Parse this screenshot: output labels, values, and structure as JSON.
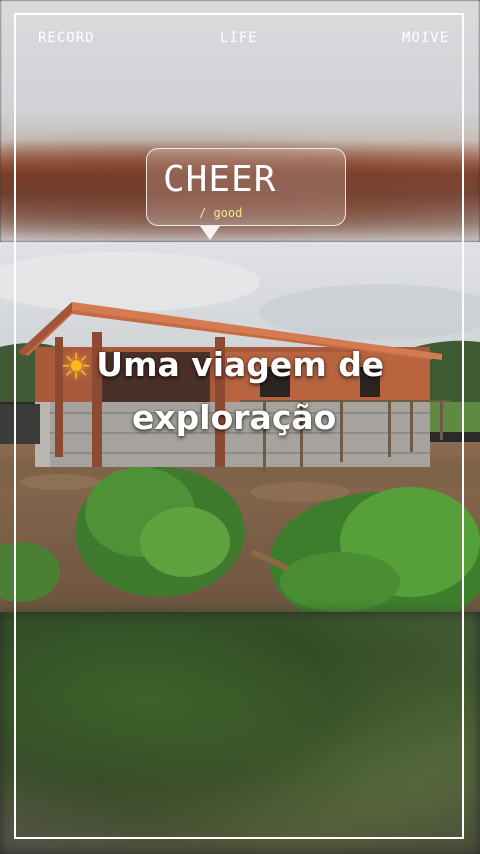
{
  "nav": {
    "record": "RECORD",
    "life": "LIFE",
    "moive": "MOIVE"
  },
  "bubble": {
    "title": "CHEER",
    "subtitle": "/ good"
  },
  "caption": {
    "icon": "sun-icon",
    "line1": "Uma viagem de",
    "line2": "exploração"
  },
  "colors": {
    "frame": "#ffffff",
    "bubble_subtitle": "#f5e58a",
    "sun": "#ffb51e"
  }
}
